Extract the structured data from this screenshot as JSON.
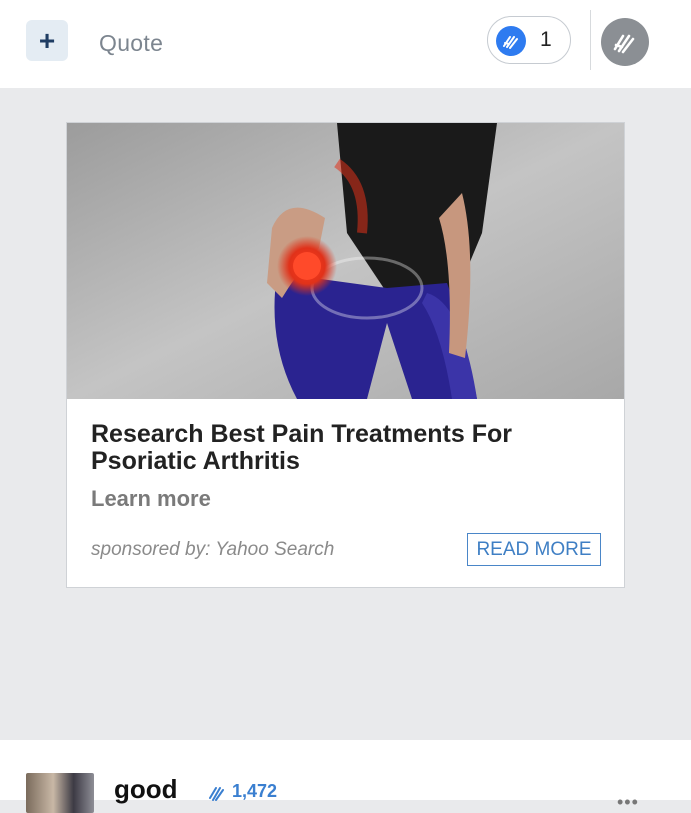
{
  "header": {
    "add_symbol": "+",
    "quote_label": "Quote",
    "like_count": "1"
  },
  "ad": {
    "title": "Research Best Pain Treatments For Psoriatic Arthritis",
    "learn_more": "Learn more",
    "sponsor": "sponsored by: Yahoo Search",
    "cta": "READ MORE"
  },
  "post": {
    "username": "good",
    "score": "1,472",
    "more": "•••"
  },
  "colors": {
    "accent": "#2e7bf0",
    "link": "#3f7fc4",
    "background": "#e9eaec"
  }
}
